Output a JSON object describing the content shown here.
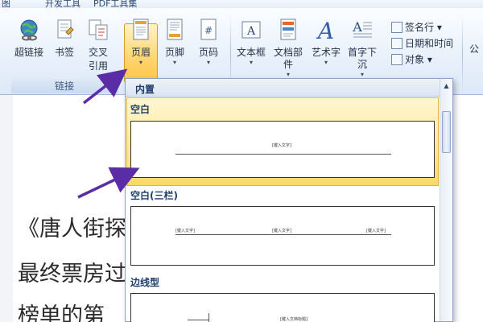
{
  "tabstrip": {
    "tabs": [
      "图",
      "开发工具",
      "PDF工具集"
    ]
  },
  "ribbon": {
    "buttons": [
      {
        "label": "超链接",
        "sub": ""
      },
      {
        "label": "书签",
        "sub": ""
      },
      {
        "label": "交叉",
        "sub": "引用"
      },
      {
        "label": "页眉",
        "sub": "▾"
      },
      {
        "label": "页脚",
        "sub": "▾"
      },
      {
        "label": "页码",
        "sub": "▾"
      },
      {
        "label": "文本框",
        "sub": "▾"
      },
      {
        "label": "文档部件",
        "sub": "▾"
      },
      {
        "label": "艺术字",
        "sub": "▾"
      },
      {
        "label": "首字下沉",
        "sub": "▾"
      },
      {
        "label": "公"
      }
    ],
    "group_link_label": "链接",
    "small_buttons": [
      "签名行 ▾",
      "日期和时间",
      "对象 ▾"
    ]
  },
  "dropdown": {
    "header": "内置",
    "sections": [
      {
        "label": "空白",
        "thumb_text": "[键入文字]"
      },
      {
        "label": "空白(三栏)",
        "thumb_texts": [
          "[键入文字]",
          "[键入文字]",
          "[键入文字]"
        ]
      },
      {
        "label": "边线型",
        "thumb_text": "[键入文档标题]"
      }
    ],
    "scroll_up": "▲"
  },
  "document": {
    "lines": [
      "《唐人街探",
      "最终票房过",
      "榜单的第"
    ]
  },
  "colors": {
    "accent": "#ffc345",
    "arrow": "#5a2da6"
  }
}
